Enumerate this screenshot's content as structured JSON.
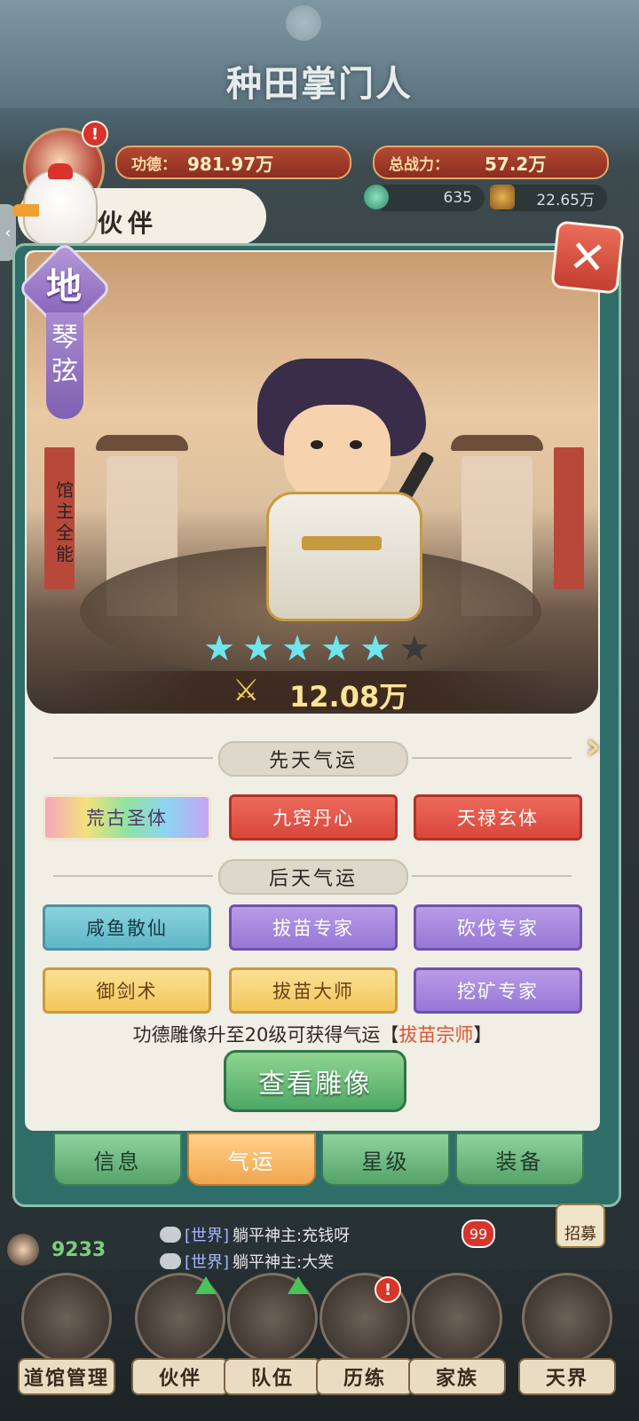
{
  "header": {
    "game_title": "种田掌门人",
    "merit_label": "功德：",
    "merit_value": "981.97万",
    "power_label": "总战力：",
    "power_value": "57.2万",
    "gems": "635",
    "coins": "22.65万",
    "avatar_badge": "!"
  },
  "panel": {
    "title": "伙伴",
    "close_label": "✕",
    "next_label": "›",
    "left_tab_label": "‹"
  },
  "hero": {
    "rank": "地",
    "name": "琴弦",
    "role": "馆主 全能",
    "stars_filled": 5,
    "stars_total": 6,
    "combat_power": "12.08万"
  },
  "fortune": {
    "innate_title": "先天气运",
    "innate": [
      "荒古圣体",
      "九窍丹心",
      "天禄玄体"
    ],
    "acquired_title": "后天气运",
    "acquired": [
      "咸鱼散仙",
      "拔苗专家",
      "砍伐专家",
      "御剑术",
      "拔苗大师",
      "挖矿专家"
    ],
    "hint_prefix": "功德雕像升至20级可获得气运【",
    "hint_highlight": "拔苗宗师",
    "hint_suffix": "】",
    "view_button": "查看雕像"
  },
  "tabs": [
    "信息",
    "气运",
    "星级",
    "装备"
  ],
  "active_tab": 1,
  "chat": {
    "player_count": "9233",
    "unread": "99",
    "lines": [
      {
        "tag": "[世界]",
        "text": "躺平神主:充钱呀"
      },
      {
        "tag": "[世界]",
        "text": "躺平神主:大笑"
      }
    ]
  },
  "recruit_label": "招募",
  "nav": [
    "道馆管理",
    "伙伴",
    "队伍",
    "历练",
    "家族",
    "天界"
  ],
  "colors": {
    "dialog_border": "#2f6e68",
    "innate_red": "#d9473a",
    "rainbow": "rainbow-gradient",
    "purple": "#9677d6",
    "gold": "#f2c759",
    "teal": "#5fb6c6"
  }
}
